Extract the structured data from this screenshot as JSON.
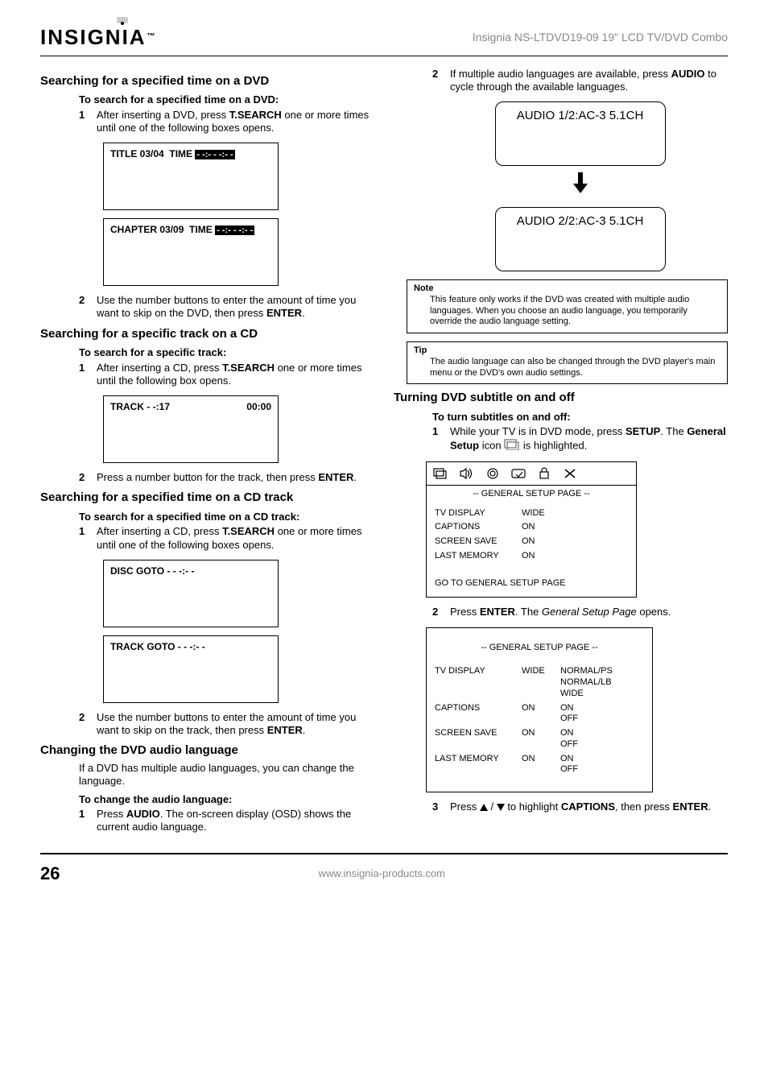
{
  "header": {
    "logo": "INSIGNIA",
    "doc_title": "Insignia NS-LTDVD19-09 19\" LCD TV/DVD Combo"
  },
  "left": {
    "h1": "Searching for a specified time on a DVD",
    "h1_sub": "To search for a specified time on a DVD:",
    "h1_s1_pre": "After inserting a DVD, press ",
    "h1_s1_bold": "T.SEARCH",
    "h1_s1_post": " one or more times until one of the following boxes opens.",
    "box1_label": "TITLE 03/04",
    "box1_time_label": "TIME",
    "box1_time_mask": "- -:- - -:- -",
    "box2_label": "CHAPTER 03/09",
    "box2_time_label": "TIME",
    "box2_time_mask": "- -:- - -:- -",
    "h1_s2_pre": "Use the number buttons to enter the amount of time you want to skip on the DVD, then press ",
    "h1_s2_bold": "ENTER",
    "h1_s2_post": ".",
    "h2": "Searching for a specific track on a CD",
    "h2_sub": "To search for a specific track:",
    "h2_s1_pre": "After inserting a CD, press ",
    "h2_s1_bold": "T.SEARCH",
    "h2_s1_post": " one or more times until the following box opens.",
    "track_box_left": "TRACK",
    "track_box_num": "- -",
    "track_box_suffix": ":17",
    "track_box_right": "00:00",
    "h2_s2_pre": "Press a number button for the track, then press ",
    "h2_s2_bold": "ENTER",
    "h2_s2_post": ".",
    "h3": "Searching for a specified time on a CD track",
    "h3_sub": "To search for a specified time on a CD track:",
    "h3_s1_pre": "After inserting a CD, press ",
    "h3_s1_bold": "T.SEARCH",
    "h3_s1_post": " one or more times until one of the following boxes opens.",
    "disc_box": "DISC GOTO",
    "disc_mask": "- - -:- -",
    "trackgoto_box": "TRACK GOTO",
    "trackgoto_mask": "- - -:- -",
    "h3_s2_pre": "Use the number buttons to enter the amount of time you want to skip on the track, then press ",
    "h3_s2_bold": "ENTER",
    "h3_s2_post": ".",
    "h4": "Changing the DVD audio language",
    "h4_intro": "If a DVD has multiple audio languages, you can change the language.",
    "h4_sub": "To change the audio language:",
    "h4_s1_pre": "Press ",
    "h4_s1_bold": "AUDIO",
    "h4_s1_post": ". The on-screen display (OSD) shows the current audio language."
  },
  "right": {
    "r_s2_pre": "If multiple audio languages are available, press ",
    "r_s2_bold": "AUDIO",
    "r_s2_post": " to cycle through the available languages.",
    "audio1": "AUDIO 1/2:AC-3 5.1CH",
    "audio2": "AUDIO 2/2:AC-3 5.1CH",
    "note_label": "Note",
    "note_text": "This feature only works if the DVD was created with multiple audio languages. When you choose an audio language, you temporarily override the audio language setting.",
    "tip_label": "Tip",
    "tip_text": "The audio language can also be changed through the DVD player's main menu or the DVD's own audio settings.",
    "h5": "Turning DVD subtitle on and off",
    "h5_sub": "To turn subtitles on and off:",
    "h5_s1_pre": "While your TV is in DVD mode, press ",
    "h5_s1_bold": "SETUP",
    "h5_s1_post1": ". The ",
    "h5_s1_bold2": "General Setup",
    "h5_s1_post2": " icon ",
    "h5_s1_post3": " is highlighted.",
    "setup_title": "-- GENERAL SETUP PAGE --",
    "setup_rows": [
      {
        "c1": "TV DISPLAY",
        "c2": "WIDE"
      },
      {
        "c1": "CAPTIONS",
        "c2": "ON"
      },
      {
        "c1": "SCREEN SAVE",
        "c2": "ON"
      },
      {
        "c1": "LAST MEMORY",
        "c2": "ON"
      }
    ],
    "setup_footer": "GO TO GENERAL SETUP PAGE",
    "h5_s2_pre": "Press ",
    "h5_s2_bold": "ENTER",
    "h5_s2_post1": ". The ",
    "h5_s2_ital": "General Setup Page",
    "h5_s2_post2": " opens.",
    "setup2_title": "-- GENERAL SETUP PAGE --",
    "setup2_rows": [
      {
        "c1": "TV DISPLAY",
        "c2": "WIDE",
        "c3": "NORMAL/PS\nNORMAL/LB\nWIDE"
      },
      {
        "c1": "CAPTIONS",
        "c2": "ON",
        "c3": "ON\nOFF"
      },
      {
        "c1": "SCREEN SAVE",
        "c2": "ON",
        "c3": "ON\nOFF"
      },
      {
        "c1": "LAST MEMORY",
        "c2": "ON",
        "c3": "ON\nOFF"
      }
    ],
    "h5_s3_pre": "Press ",
    "h5_s3_mid": " to highlight ",
    "h5_s3_bold": "CAPTIONS",
    "h5_s3_post": ", then press ",
    "h5_s3_bold2": "ENTER",
    "h5_s3_end": "."
  },
  "footer": {
    "page": "26",
    "url": "www.insignia-products.com"
  }
}
